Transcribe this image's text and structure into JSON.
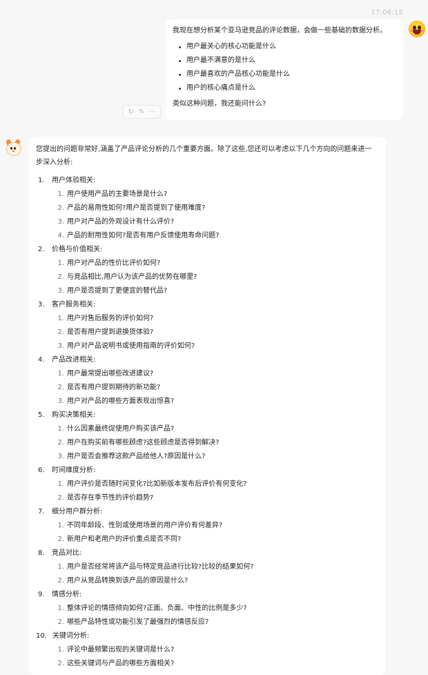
{
  "timestamp": "17:06:15",
  "user_message": {
    "intro": "我现在想分析某个亚马逊竞品的评论数据，会做一些基础的数据分析。",
    "bullets": [
      "用户最关心的核心功能是什么",
      "用户最不满意的是什么",
      "用户最喜欢的产品核心功能是什么",
      "用户的核心痛点是什么"
    ],
    "outro": "类似这种问题，我还能问什么?"
  },
  "message_actions": {
    "retry_icon": "↻",
    "edit_icon": "✎",
    "more_icon": "···"
  },
  "assistant_message": {
    "intro": "您提出的问题非常好,涵盖了产品评论分析的几个重要方面。除了这些,您还可以考虑以下几个方向的问题来进一步深入分析:",
    "sections": [
      {
        "n": "1.",
        "title": "用户体验相关:",
        "items": [
          {
            "n": "1.",
            "t": "用户使用产品的主要场景是什么?"
          },
          {
            "n": "2.",
            "t": "产品的易用性如何?用户是否提到了使用难度?"
          },
          {
            "n": "3.",
            "t": "用户对产品的外观设计有什么评价?"
          },
          {
            "n": "4.",
            "t": "产品的耐用性如何?是否有用户反馈使用寿命问题?"
          }
        ]
      },
      {
        "n": "2.",
        "title": "价格与价值相关:",
        "items": [
          {
            "n": "1.",
            "t": "用户对产品的性价比评价如何?"
          },
          {
            "n": "2.",
            "t": "与竞品相比,用户认为该产品的优势在哪里?"
          },
          {
            "n": "3.",
            "t": "用户是否提到了更便宜的替代品?"
          }
        ]
      },
      {
        "n": "3.",
        "title": "客户服务相关:",
        "items": [
          {
            "n": "1.",
            "t": "用户对售后服务的评价如何?"
          },
          {
            "n": "2.",
            "t": "是否有用户提到退换货体验?"
          },
          {
            "n": "3.",
            "t": "用户对产品说明书或使用指南的评价如何?"
          }
        ]
      },
      {
        "n": "4.",
        "title": "产品改进相关:",
        "items": [
          {
            "n": "1.",
            "t": "用户最常提出哪些改进建议?"
          },
          {
            "n": "2.",
            "t": "是否有用户提到期待的新功能?"
          },
          {
            "n": "3.",
            "t": "用户对产品的哪些方面表现出惊喜?"
          }
        ]
      },
      {
        "n": "5.",
        "title": "购买决策相关:",
        "items": [
          {
            "n": "1.",
            "t": "什么因素最终促使用户购买该产品?"
          },
          {
            "n": "2.",
            "t": "用户在购买前有哪些顾虑?这些顾虑是否得到解决?"
          },
          {
            "n": "3.",
            "t": "用户是否会推荐这款产品给他人?原因是什么?"
          }
        ]
      },
      {
        "n": "6.",
        "title": "时间维度分析:",
        "items": [
          {
            "n": "1.",
            "t": "用户评价是否随时间变化?比如新版本发布后评价有何变化?"
          },
          {
            "n": "2.",
            "t": "是否存在季节性的评价趋势?"
          }
        ]
      },
      {
        "n": "7.",
        "title": "细分用户群分析:",
        "items": [
          {
            "n": "1.",
            "t": "不同年龄段、性别或使用场景的用户评价有何差异?"
          },
          {
            "n": "2.",
            "t": "新用户和老用户的评价重点是否不同?"
          }
        ]
      },
      {
        "n": "8.",
        "title": "竞品对比:",
        "items": [
          {
            "n": "1.",
            "t": "用户是否经常将该产品与特定竞品进行比较?比较的结果如何?"
          },
          {
            "n": "2.",
            "t": "用户从竞品转换到该产品的原因是什么?"
          }
        ]
      },
      {
        "n": "9.",
        "title": "情感分析:",
        "items": [
          {
            "n": "1.",
            "t": "整体评论的情感倾向如何?正面、负面、中性的比例是多少?"
          },
          {
            "n": "2.",
            "t": "哪些产品特性或功能引发了最强烈的情感反应?"
          }
        ]
      },
      {
        "n": "10.",
        "title": "关键词分析:",
        "items": [
          {
            "n": "1.",
            "t": "评论中最频繁出现的关键词是什么?"
          },
          {
            "n": "2.",
            "t": "这些关键词与产品的哪些方面相关?"
          }
        ]
      }
    ]
  }
}
